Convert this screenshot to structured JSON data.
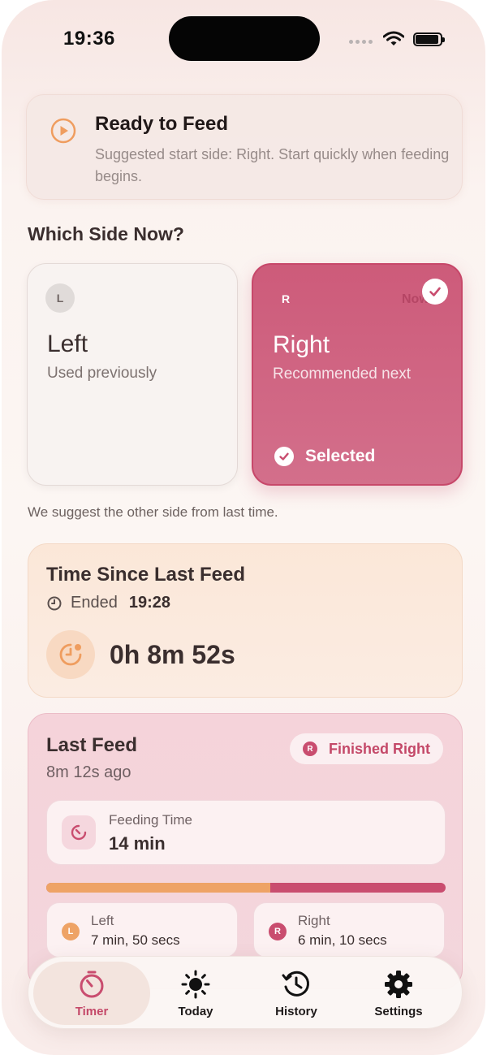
{
  "status_bar": {
    "time": "19:36"
  },
  "ready_banner": {
    "icon": "play-circle-icon",
    "title": "Ready to Feed",
    "text": "Suggested start side: Right. Start quickly when feeding begins."
  },
  "side_section": {
    "title": "Which Side Now?",
    "left": {
      "letter": "L",
      "name": "Left",
      "subtitle": "Used previously"
    },
    "right": {
      "letter": "R",
      "name": "Right",
      "subtitle": "Recommended next",
      "faint_tag": "Now",
      "selected_label": "Selected"
    },
    "hint": "We suggest the other side from last time."
  },
  "time_since": {
    "title": "Time Since Last Feed",
    "ended_label": "Ended",
    "ended_time": "19:28",
    "elapsed": "0h 8m 52s"
  },
  "last_feed": {
    "title": "Last Feed",
    "ago": "8m 12s ago",
    "finished_badge_letter": "R",
    "finished_label": "Finished Right",
    "feeding_time_label": "Feeding Time",
    "feeding_time_value": "14 min",
    "left_share": 0.56,
    "left": {
      "letter": "L",
      "label": "Left",
      "value": "7 min, 50 secs"
    },
    "right": {
      "letter": "R",
      "label": "Right",
      "value": "6 min, 10 secs"
    }
  },
  "tabs": [
    {
      "label": "Timer",
      "icon": "timer-icon",
      "active": true
    },
    {
      "label": "Today",
      "icon": "sun-icon",
      "active": false
    },
    {
      "label": "History",
      "icon": "history-icon",
      "active": false
    },
    {
      "label": "Settings",
      "icon": "gear-icon",
      "active": false
    }
  ],
  "colors": {
    "accent_pink": "#c94d6f",
    "accent_orange": "#eea366",
    "selected_card": "#cd5b7a"
  }
}
